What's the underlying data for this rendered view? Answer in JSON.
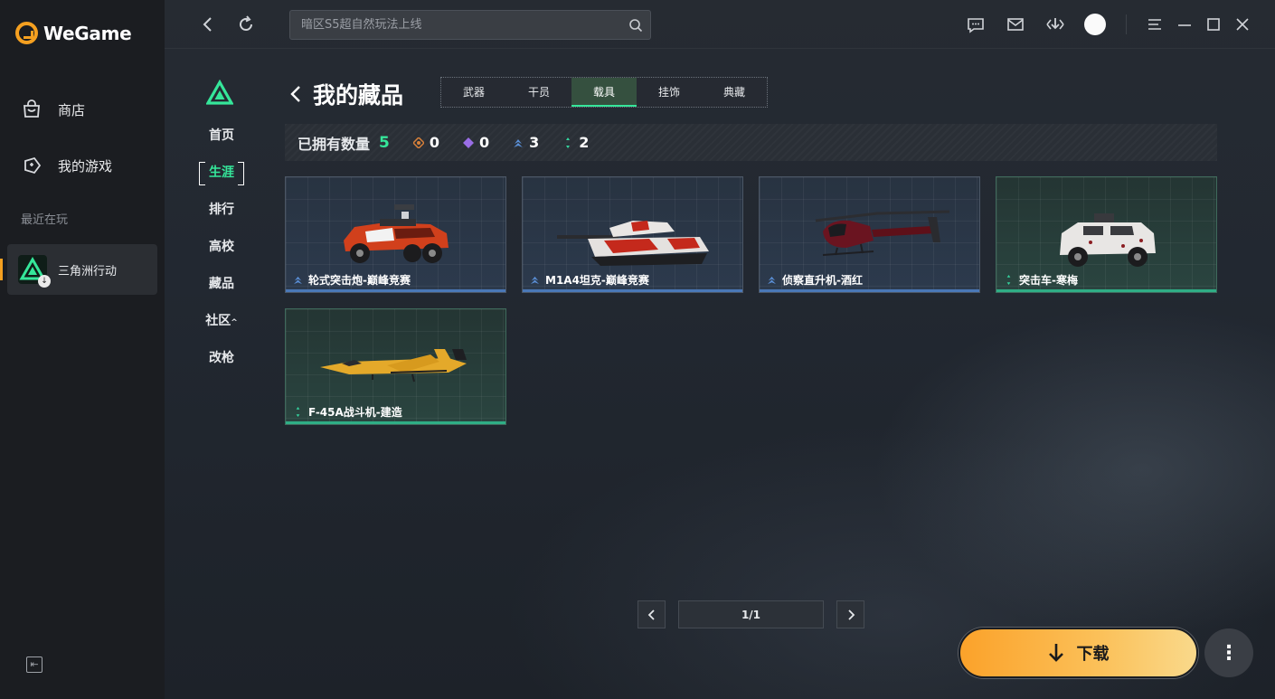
{
  "app": {
    "logo_text": "WeGame",
    "nav": [
      {
        "label": "商店",
        "icon": "shopping-bag-icon"
      },
      {
        "label": "我的游戏",
        "icon": "gamepad-icon"
      }
    ],
    "recent_label": "最近在玩",
    "recent_game": "三角洲行动"
  },
  "topbar": {
    "search_placeholder": "暗区S5超自然玩法上线"
  },
  "game_nav": {
    "items": [
      "首页",
      "生涯",
      "排行",
      "高校",
      "藏品",
      "社区",
      "改枪"
    ],
    "active": "生涯",
    "community_caret": "^"
  },
  "page": {
    "title": "我的藏品",
    "tabs": [
      "武器",
      "干员",
      "载具",
      "挂饰",
      "典藏"
    ],
    "active_tab": "载具"
  },
  "owned": {
    "label": "已拥有数量",
    "total": "5",
    "rarities": [
      {
        "icon": "orange-diamond-icon",
        "color": "#d9813a",
        "count": "0"
      },
      {
        "icon": "purple-diamond-icon",
        "color": "#9a6ee6",
        "count": "0"
      },
      {
        "icon": "blue-chevrons-icon",
        "color": "#5a8fd6",
        "count": "3"
      },
      {
        "icon": "green-dots-icon",
        "color": "#35d6a0",
        "count": "2"
      }
    ]
  },
  "items": [
    {
      "name": "轮式突击炮-巅峰竞赛",
      "rarity": "blue"
    },
    {
      "name": "M1A4坦克-巅峰竞赛",
      "rarity": "blue"
    },
    {
      "name": "侦察直升机-酒红",
      "rarity": "blue"
    },
    {
      "name": "突击车-寒梅",
      "rarity": "green"
    },
    {
      "name": "F-45A战斗机-建造",
      "rarity": "green"
    }
  ],
  "pagination": {
    "text": "1/1"
  },
  "actions": {
    "download_label": "下载",
    "more_label": "⋮"
  },
  "colors": {
    "accent_green": "#35e69a",
    "download_orange": "#fba22a"
  }
}
